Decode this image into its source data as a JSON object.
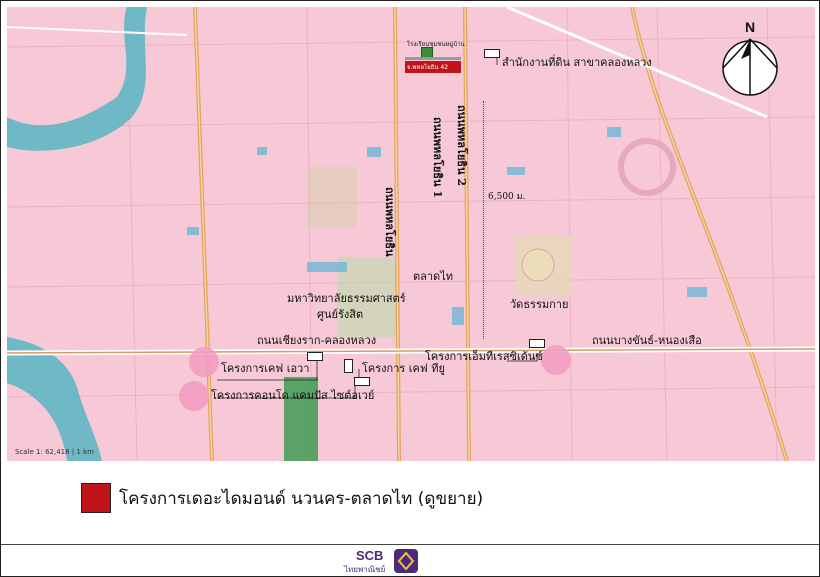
{
  "map": {
    "compass_label": "N",
    "scale_text": "Scale 1: 62,418 | 1 km",
    "distance_label": "6,500 ม.",
    "roads": {
      "phahonyothin": "ถนนพหลโยธิน",
      "paholyothin1": "ถนนพหลโยธิน 1",
      "paholyothin2": "ถนนพหลโยธิน 2",
      "chiangrak": "ถนนเชียงราก-คลองหลวง",
      "bangkhan": "ถนนบางขันธ์-หนองเสือ"
    },
    "places": {
      "land_office": "สำนักงานที่ดิน สาขาคลองหลวง",
      "market": "ตลาดไท",
      "wat": "วัดธรรมกาย",
      "university_line1": "มหาวิทยาลัยธรรมศาสตร์",
      "university_line2": "ศูนย์รังสิต",
      "top_small_1": "โรงเรียนชุมชนหมู่บ้าน",
      "target_small": "จ.พหลโยธิน 42"
    },
    "projects": {
      "kave_aura": "โครงการเคฟ เอวา",
      "kave_tu": "โครงการ เคฟ ทียู",
      "emthisri": "โครงการเอ็มทีเรสซิเด้นซ์",
      "campus_condo": "โครงการคอนโด แคมปัส ไซต์อเวย์"
    },
    "colors": {
      "background": "#f7c9d6",
      "target": "#c0141c",
      "project_dot": "#f29bc0"
    }
  },
  "legend": {
    "label": "โครงการเดอะไดมอนด์ นวนคร-ตลาดไท (ดูขยาย)"
  },
  "footer": {
    "brand": "SCB",
    "brand_sub": "ไทยพาณิชย์"
  }
}
